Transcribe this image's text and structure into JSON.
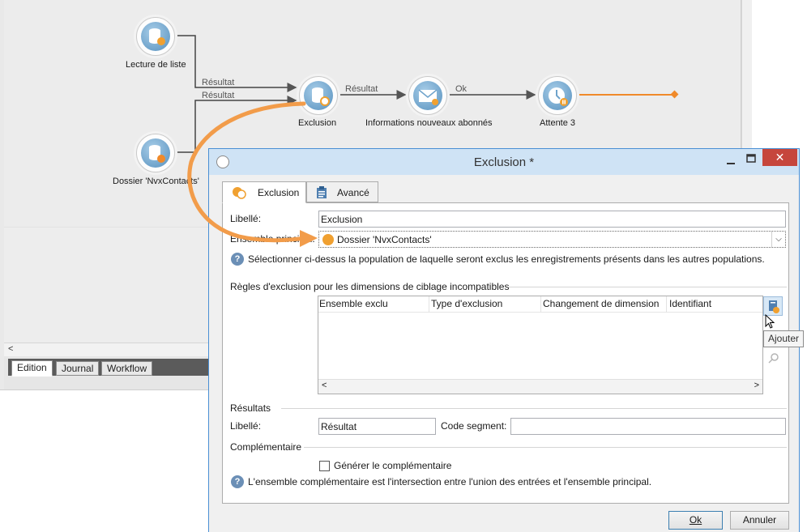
{
  "workflow": {
    "nodes": {
      "lecture": "Lecture de liste",
      "dossier": "Dossier 'NvxContacts'",
      "exclusion": "Exclusion",
      "informations": "Informations nouveaux abonnés",
      "attente": "Attente 3"
    },
    "transitions": {
      "resultat1": "Résultat",
      "resultat2": "Résultat",
      "resultat3": "Résultat",
      "ok": "Ok"
    },
    "scroll_left_arrow": "<",
    "tabs": [
      "Edition",
      "Journal",
      "Workflow"
    ],
    "active_tab": "Edition",
    "colors": {
      "node": "#6fa3cb",
      "arrow_accent": "#f29c4a"
    }
  },
  "dialog": {
    "title": "Exclusion *",
    "controls": {
      "minimize": "—",
      "maximize": "□",
      "close": "✕"
    },
    "tabs": [
      {
        "label": "Exclusion",
        "icon": "exclusion-icon"
      },
      {
        "label": "Avancé",
        "icon": "clipboard-icon"
      }
    ],
    "libelle_label": "Libellé:",
    "libelle_value": "Exclusion",
    "ensemble_label": "Ensemble principal:",
    "ensemble_value": "Dossier 'NvxContacts'",
    "help1": "Sélectionner ci-dessus la population de laquelle seront exclus les enregistrements présents dans les autres populations.",
    "rules_section": "Règles d'exclusion pour les dimensions de ciblage incompatibles",
    "grid_columns": [
      "Ensemble exclu",
      "Type d'exclusion",
      "Changement de dimension",
      "Identifiant"
    ],
    "grid_scroll_left": "<",
    "grid_scroll_right": ">",
    "tooltip": "Ajouter",
    "results_section": "Résultats",
    "result_libelle_label": "Libellé:",
    "result_libelle_value": "Résultat",
    "code_segment_label": "Code segment:",
    "code_segment_value": "",
    "complementary_section": "Complémentaire",
    "generate_checkbox_label": "Générer le complémentaire",
    "help2": "L'ensemble complémentaire est l'intersection entre l'union des entrées et l'ensemble principal.",
    "ok_label": "Ok",
    "cancel_label": "Annuler",
    "colors": {
      "titlebar": "#cfe3f5",
      "close": "#c6463c",
      "accent_orange": "#f0a030"
    }
  }
}
